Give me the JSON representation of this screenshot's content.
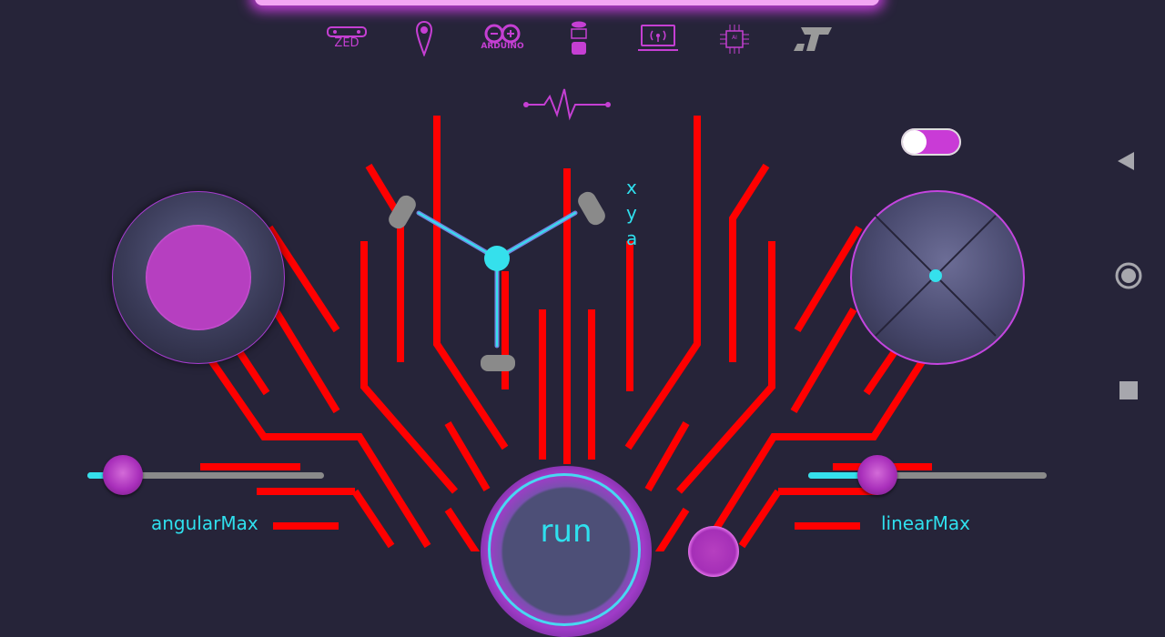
{
  "toolbar": {
    "icons": [
      "zed-icon",
      "location-pin-icon",
      "arduino-icon",
      "database-icon",
      "laptop-broadcast-icon",
      "chip-icon",
      "st-logo-icon"
    ],
    "zed_label": "ZED",
    "arduino_label": "ARDUINO",
    "chip_label": "AI"
  },
  "pulse_icon": "heartbeat-icon",
  "robot": {
    "axes": [
      "x",
      "y",
      "a"
    ]
  },
  "toggle": {
    "on": true
  },
  "sliders": {
    "angular": {
      "label": "angularMax",
      "value": 0.15
    },
    "linear": {
      "label": "linearMax",
      "value": 0.29
    }
  },
  "run_button": {
    "label": "run"
  },
  "nav": {
    "back": "back-icon",
    "home": "home-icon",
    "recents": "recents-icon"
  },
  "colors": {
    "background": "#262439",
    "accent_magenta": "#c53fd3",
    "accent_cyan": "#2fe0ee",
    "circuit_red": "#ff0000"
  }
}
